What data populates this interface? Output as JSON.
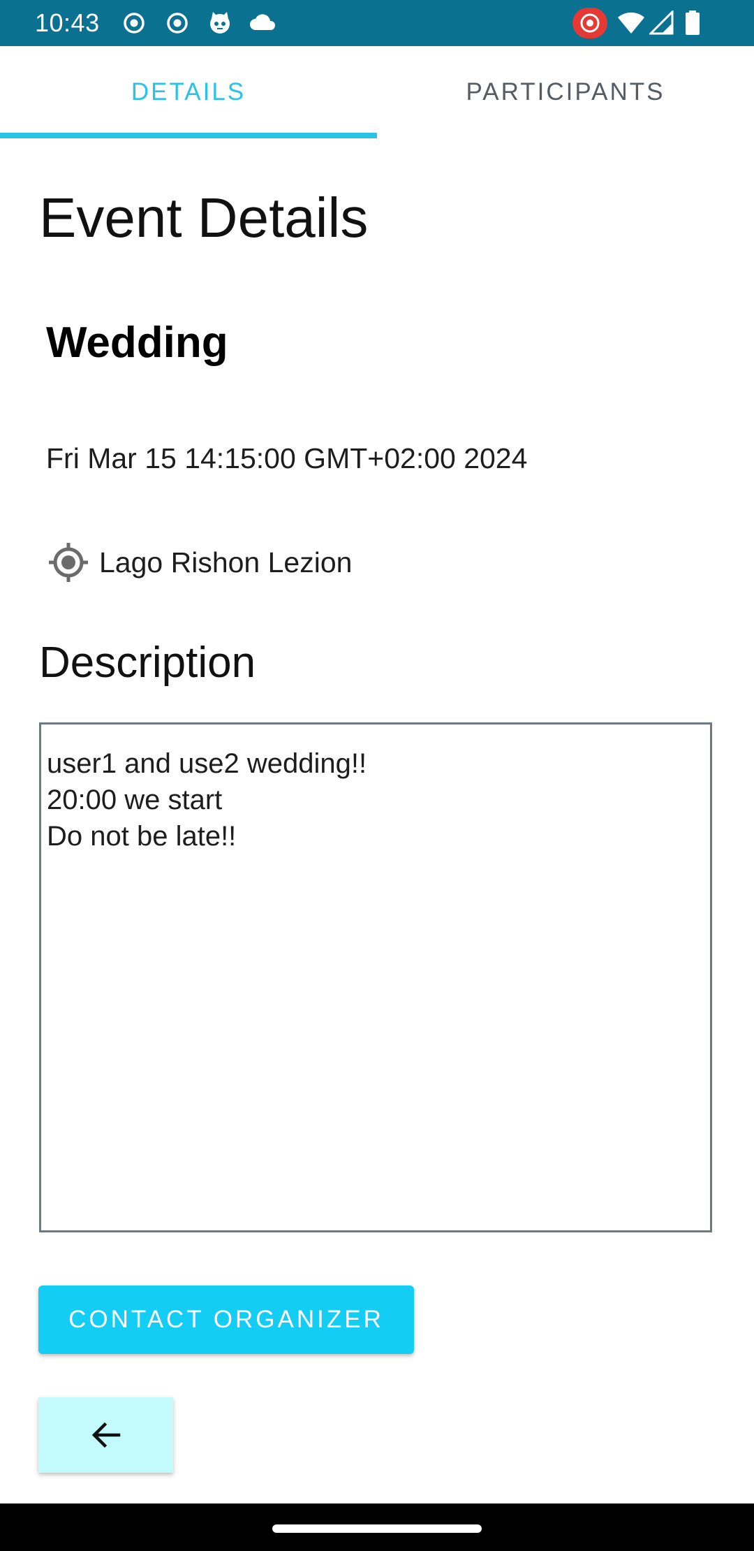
{
  "status_bar": {
    "time": "10:43",
    "icons": [
      "radio-target-icon",
      "radio-target-icon",
      "cat-icon",
      "cloud-icon",
      "record-icon",
      "wifi-icon",
      "signal-icon",
      "battery-icon"
    ],
    "background_color": "#0b7191",
    "record_color": "#e53935"
  },
  "tabs": [
    {
      "label": "DETAILS",
      "active": true
    },
    {
      "label": "PARTICIPANTS",
      "active": false
    }
  ],
  "accent_color": "#29c3e8",
  "page_title": "Event Details",
  "event": {
    "name": "Wedding",
    "date": "Fri Mar 15 14:15:00 GMT+02:00 2024",
    "location": "Lago Rishon Lezion",
    "location_icon": "gps-location-icon"
  },
  "description": {
    "heading": "Description",
    "lines": [
      "user1 and use2 wedding!!",
      "20:00 we start",
      "Do not be late!!"
    ]
  },
  "contact_button": {
    "label": "CONTACT ORGANIZER",
    "color": "#13cdf5"
  },
  "back_button": {
    "icon": "arrow-left-icon",
    "color": "#c3fbfd"
  }
}
